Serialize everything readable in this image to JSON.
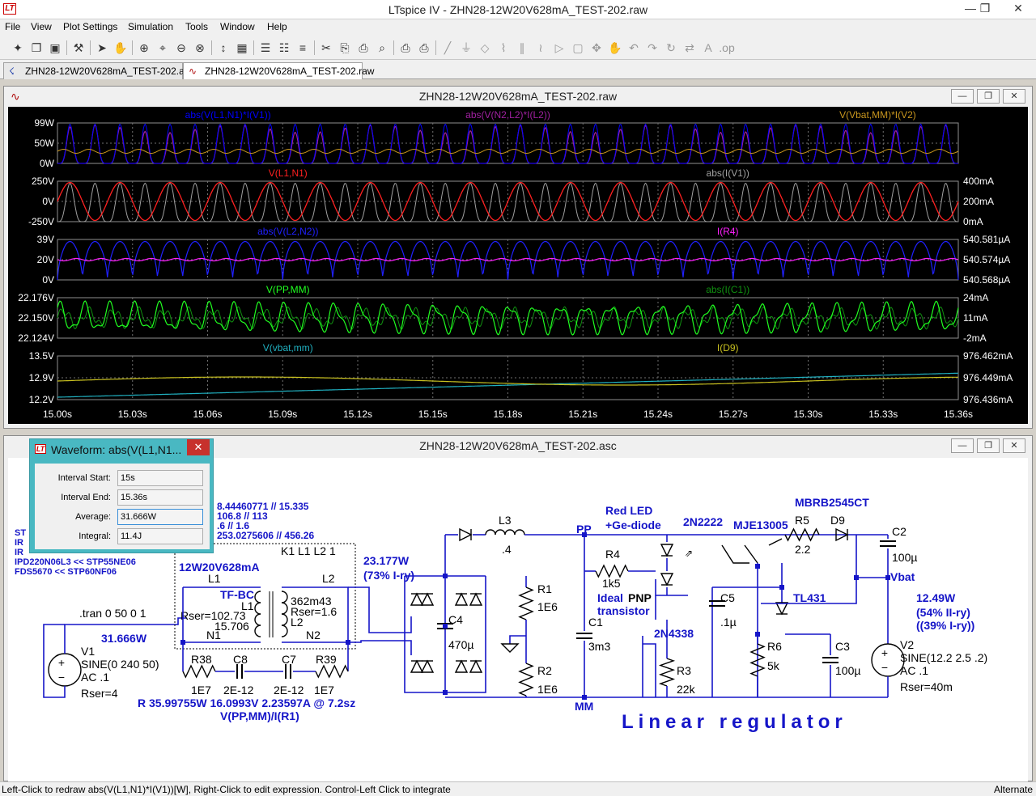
{
  "window": {
    "title": "LTspice IV - ZHN28-12W20V628mA_TEST-202.raw",
    "icon_label": "LT",
    "minimize": "—",
    "restore": "❐",
    "close": "✕"
  },
  "menu": [
    "File",
    "View",
    "Plot Settings",
    "Simulation",
    "Tools",
    "Window",
    "Help"
  ],
  "toolbar_icons": [
    "new-schematic-icon",
    "open-icon",
    "save-icon",
    "control-panel-icon",
    "run-icon",
    "halt-icon",
    "zoom-in-icon",
    "zoom-pan-icon",
    "zoom-out-icon",
    "zoom-cancel-icon",
    "autorange-icon",
    "grid-icon",
    "tile-horizontal-icon",
    "cascade-icon",
    "tile-vertical-icon",
    "cut-icon",
    "copy-icon",
    "paste-icon",
    "find-icon",
    "print-preview-icon",
    "print-icon",
    "wire-icon",
    "ground-icon",
    "label-icon",
    "resistor-icon",
    "capacitor-icon",
    "inductor-icon",
    "diode-icon",
    "component-icon",
    "move-icon",
    "drag-icon",
    "undo-icon",
    "redo-icon",
    "rotate-icon",
    "mirror-icon",
    "text-icon",
    "spice-directive-icon"
  ],
  "tabs": [
    {
      "label": "ZHN28-12W20V628mA_TEST-202.asc",
      "icon": "schematic-icon"
    },
    {
      "label": "ZHN28-12W20V628mA_TEST-202.raw",
      "icon": "waveform-icon"
    }
  ],
  "plot_window": {
    "title": "ZHN28-12W20V628mA_TEST-202.raw",
    "panes": [
      {
        "left_traces": [
          {
            "label": "abs(V(L1,N1)*I(V1))",
            "color": "#0000ff"
          },
          {
            "label": "abs(V(N2,L2)*I(L2))",
            "color": "#a020a0"
          },
          {
            "label": "V(Vbat,MM)*I(V2)",
            "color": "#c8961e"
          }
        ],
        "left_ticks": [
          "99W",
          "50W",
          "0W"
        ],
        "right_ticks": []
      },
      {
        "left_traces": [
          {
            "label": "V(L1,N1)",
            "color": "#ff2020"
          }
        ],
        "right_traces": [
          {
            "label": "abs(I(V1))",
            "color": "#a0a0a0"
          }
        ],
        "left_ticks": [
          "250V",
          "0V",
          "-250V"
        ],
        "right_ticks": [
          "400mA",
          "200mA",
          "0mA"
        ]
      },
      {
        "left_traces": [
          {
            "label": "abs(V(L2,N2))",
            "color": "#2020ff"
          }
        ],
        "right_traces": [
          {
            "label": "I(R4)",
            "color": "#ff20ff"
          }
        ],
        "left_ticks": [
          "39V",
          "20V",
          "0V"
        ],
        "right_ticks": [
          "540.581µA",
          "540.574µA",
          "540.568µA"
        ]
      },
      {
        "left_traces": [
          {
            "label": "V(PP,MM)",
            "color": "#20ff20"
          }
        ],
        "right_traces": [
          {
            "label": "abs(I(C1))",
            "color": "#109010"
          }
        ],
        "left_ticks": [
          "22.176V",
          "22.150V",
          "22.124V"
        ],
        "right_ticks": [
          "24mA",
          "11mA",
          "-2mA"
        ]
      },
      {
        "left_traces": [
          {
            "label": "V(vbat,mm)",
            "color": "#20b0c0"
          }
        ],
        "right_traces": [
          {
            "label": "I(D9)",
            "color": "#c8c020"
          }
        ],
        "left_ticks": [
          "13.5V",
          "12.9V",
          "12.2V"
        ],
        "right_ticks": [
          "976.462mA",
          "976.449mA",
          "976.436mA"
        ]
      }
    ],
    "x_ticks": [
      "15.00s",
      "15.03s",
      "15.06s",
      "15.09s",
      "15.12s",
      "15.15s",
      "15.18s",
      "15.21s",
      "15.24s",
      "15.27s",
      "15.30s",
      "15.33s",
      "15.36s"
    ]
  },
  "schematic_window": {
    "title": "ZHN28-12W20V628mA_TEST-202.asc",
    "texts": {
      "partial_1": "8.44460771 // 15.335",
      "partial_2": "106.8 // 113",
      "partial_3": ".6 // 1.6",
      "partial_4": "253.0275606 // 456.26",
      "side_st": "ST",
      "side_ir1": "IR",
      "side_ir2": "IR",
      "ipd": "IPD220N06L3 << STP55NE06",
      "fds": "FDS5670 << STP60NF06",
      "k1": "K1 L1 L2 1",
      "model": "12W20V628mA",
      "l1_top": "L1",
      "l2_top": "L2",
      "tfbc": "TF-BC",
      "l1_mid": "L1",
      "l2_mid": "L2",
      "rser1": "Rser=102.73",
      "ind1": "15.706",
      "ind2": "362m43",
      "rser2": "Rser=1.6",
      "n1": "N1",
      "n2": "N2",
      "tran": ".tran 0 50 0 1",
      "pin": "31.666W",
      "v1": "V1",
      "v1_src": "SINE(0 240 50)",
      "v1_ac": "AC .1",
      "v1_rser": "Rser=4",
      "r38": "R38",
      "r38v": "1E7",
      "c8": "C8",
      "c8v": "2E-12",
      "c7": "C7",
      "c7v": "2E-12",
      "r39": "R39",
      "r39v": "1E7",
      "rcalc": "R 35.99755W 16.0993V 2.23597A  @ 7.2sz",
      "rexpr": "V(PP,MM)/I(R1)",
      "psec": "23.177W",
      "psec_pct": "(73% I-ry)",
      "l3": "L3",
      "l3v": ".4",
      "pp": "PP",
      "mm": "MM",
      "c4": "C4",
      "c4v": "470µ",
      "r1": "R1",
      "r1v": "1E6",
      "r2": "R2",
      "r2v": "1E6",
      "c1": "C1",
      "c1v": "3m3",
      "r4": "R4",
      "r4v": "1k5",
      "redled": "Red LED",
      "gediode": "+Ge-diode",
      "ideal": "Ideal",
      "pnp": "PNP",
      "transistor": "transistor",
      "q2n2222": "2N2222",
      "mje": "MJE13005",
      "q2n4338": "2N4338",
      "r3": "R3",
      "r3v": "22k",
      "c5": "C5",
      "c5v": ".1µ",
      "r5": "R5",
      "r5v": "2.2",
      "d9": "D9",
      "mbrb": "MBRB2545CT",
      "c2": "C2",
      "c2v": "100µ",
      "vbat": "Vbat",
      "tl431": "TL431",
      "r6": "R6",
      "r6v": "5k",
      "c3": "C3",
      "c3v": "100µ",
      "pout": "12.49W",
      "pout_pct1": "(54% II-ry)",
      "pout_pct2": "((39% I-ry))",
      "v2": "V2",
      "v2_src": "SINE(12.2 2.5 .2)",
      "v2_ac": "AC .1",
      "v2_rser": "Rser=40m",
      "title_text": "Linear regulator"
    }
  },
  "dialog": {
    "title": "Waveform: abs(V(L1,N1...",
    "close": "✕",
    "rows": [
      {
        "label": "Interval Start:",
        "value": "15s"
      },
      {
        "label": "Interval End:",
        "value": "15.36s"
      },
      {
        "label": "Average:",
        "value": "31.666W"
      },
      {
        "label": "Integral:",
        "value": "11.4J"
      }
    ]
  },
  "status": {
    "left": "Left-Click to redraw abs(V(L1,N1)*I(V1))[W],  Right-Click to edit expression. Control-Left Click to integrate",
    "right": "Alternate"
  }
}
